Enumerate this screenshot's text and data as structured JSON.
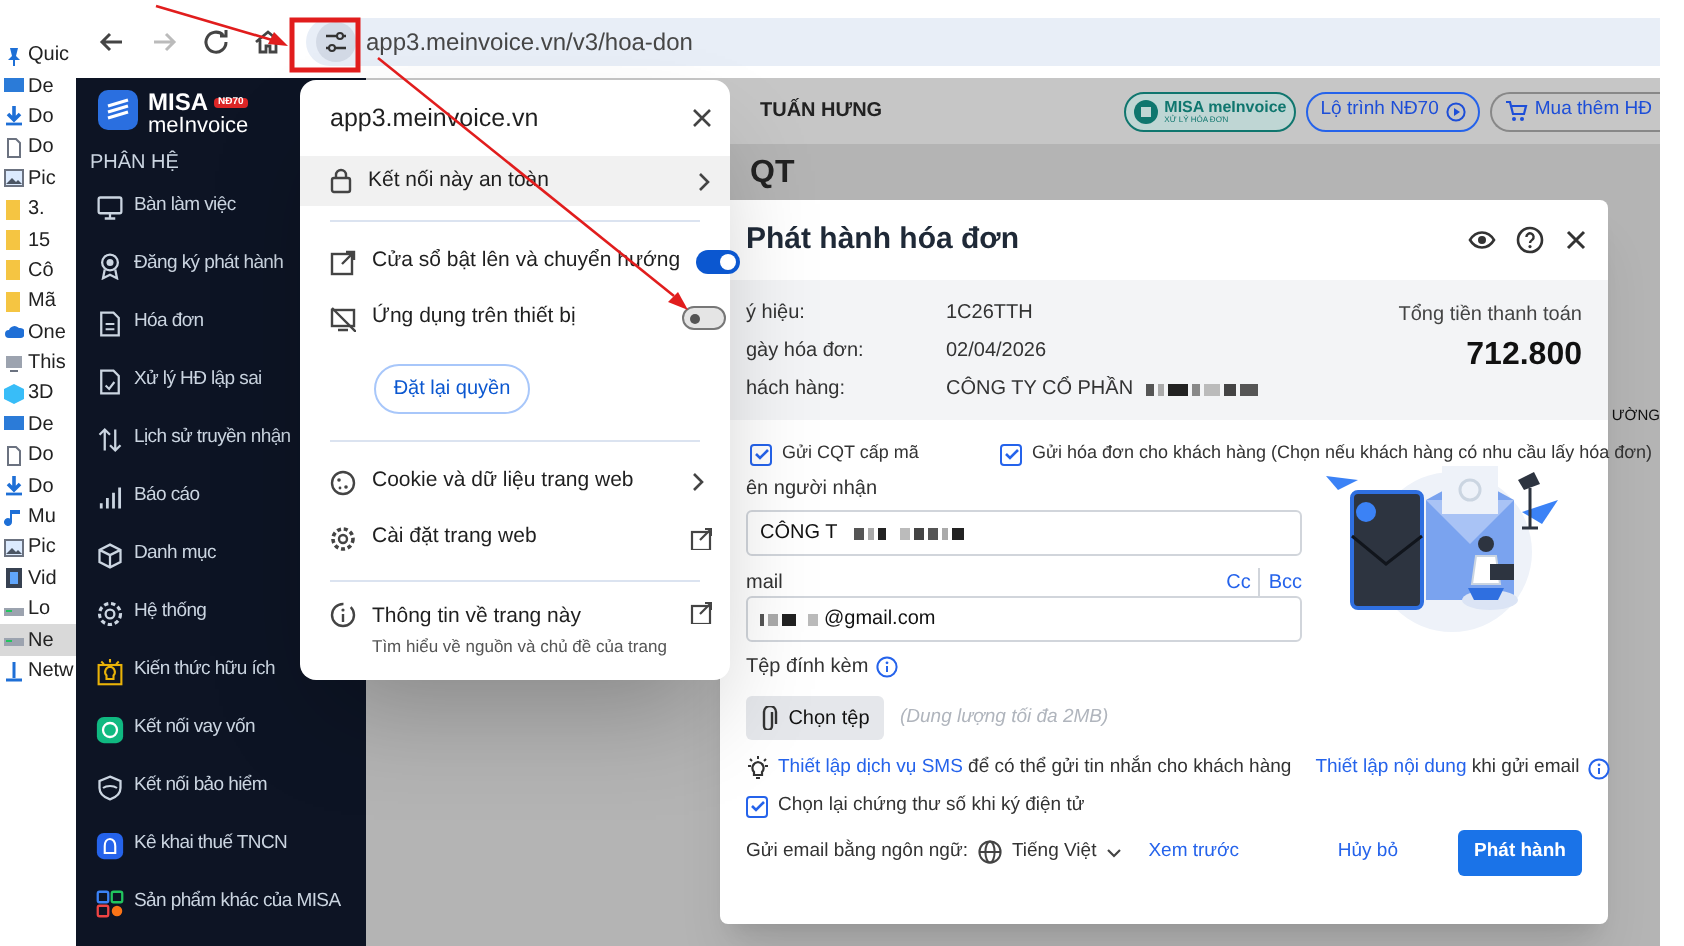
{
  "explorer_items": [
    {
      "label": "Quic",
      "kind": "pin",
      "selected": false
    },
    {
      "label": "De",
      "kind": "desktop",
      "selected": false
    },
    {
      "label": "Do",
      "kind": "download",
      "selected": false
    },
    {
      "label": "Do",
      "kind": "document",
      "selected": false
    },
    {
      "label": "Pic",
      "kind": "pictures",
      "selected": false
    },
    {
      "label": "3.",
      "kind": "folder",
      "selected": false
    },
    {
      "label": "15",
      "kind": "folder",
      "selected": false
    },
    {
      "label": "Cô",
      "kind": "folder",
      "selected": false
    },
    {
      "label": "Mã",
      "kind": "folder",
      "selected": false
    },
    {
      "label": "One",
      "kind": "cloud",
      "selected": false
    },
    {
      "label": "This",
      "kind": "pc",
      "selected": false
    },
    {
      "label": "3D",
      "kind": "cube",
      "selected": false
    },
    {
      "label": "De",
      "kind": "desktop",
      "selected": false
    },
    {
      "label": "Do",
      "kind": "document",
      "selected": false
    },
    {
      "label": "Do",
      "kind": "download",
      "selected": false
    },
    {
      "label": "Mu",
      "kind": "music",
      "selected": false
    },
    {
      "label": "Pic",
      "kind": "pictures",
      "selected": false
    },
    {
      "label": "Vid",
      "kind": "video",
      "selected": false
    },
    {
      "label": "Lo",
      "kind": "drive",
      "selected": false
    },
    {
      "label": "Ne",
      "kind": "drive",
      "selected": true
    },
    {
      "label": "Netw",
      "kind": "network",
      "selected": false
    }
  ],
  "browser": {
    "url": "app3.meinvoice.vn/v3/hoa-don"
  },
  "sidebar": {
    "logo_top": "MISA",
    "logo_bottom": "meInvoice",
    "badge": "NĐ70",
    "section": "PHÂN HỆ",
    "items": [
      {
        "label": "Bàn làm việc",
        "kind": "desktop"
      },
      {
        "label": "Đăng ký phát hành",
        "kind": "award"
      },
      {
        "label": "Hóa đơn",
        "kind": "document"
      },
      {
        "label": "Xử lý HĐ lập sai",
        "kind": "document_check"
      },
      {
        "label": "Lịch sử truyền nhận",
        "kind": "transfer"
      },
      {
        "label": "Báo cáo",
        "kind": "chart"
      },
      {
        "label": "Danh mục",
        "kind": "box"
      },
      {
        "label": "Hệ thống",
        "kind": "gear"
      },
      {
        "label": "Kiến thức hữu ích",
        "kind": "bulb"
      },
      {
        "label": "Kết nối vay vốn",
        "kind": "loan"
      },
      {
        "label": "Kết nối bảo hiểm",
        "kind": "shield"
      },
      {
        "label": "Kê khai thuế TNCN",
        "kind": "tax"
      },
      {
        "label": "Sản phẩm khác của MISA",
        "kind": "apps"
      }
    ]
  },
  "header": {
    "company": "TUẤN HƯNG",
    "buttons": [
      {
        "kind": "brand",
        "label": "MISA meInvoice",
        "sublabel": "XỬ LÝ HÓA ĐƠN"
      },
      {
        "kind": "route",
        "label": "Lộ trình NĐ70"
      },
      {
        "kind": "buy",
        "label": "Mua thêm HĐ"
      }
    ]
  },
  "page": {
    "title": "QT",
    "column_fragment": "ƯỜNG"
  },
  "site_popup": {
    "domain": "app3.meinvoice.vn",
    "connection": "Kết nối này an toàn",
    "permissions": [
      {
        "label": "Cửa sổ bật lên và chuyển hướng",
        "kind": "popup",
        "on": true
      },
      {
        "label": "Ứng dụng trên thiết bị",
        "kind": "device",
        "on": false
      }
    ],
    "reset_button": "Đặt lại quyền",
    "links": [
      {
        "label": "Cookie và dữ liệu trang web",
        "kind": "cookie"
      },
      {
        "label": "Cài đặt trang web",
        "kind": "settings"
      }
    ],
    "about": {
      "title": "Thông tin về trang này",
      "subtitle": "Tìm hiểu về nguồn và chủ đề của trang"
    }
  },
  "dialog": {
    "title": "Phát hành hóa đơn",
    "info": [
      {
        "label": "ý hiệu:",
        "value": "1C26TTH",
        "redacted": false
      },
      {
        "label": "gày hóa đơn:",
        "value": "02/04/2026",
        "redacted": false
      },
      {
        "label": "hách hàng:",
        "value": "CÔNG TY CỔ PHẦN",
        "redacted": true
      }
    ],
    "total_label": "Tổng tiền thanh toán",
    "total": "712.800",
    "options": [
      {
        "label": "Gửi CQT cấp mã",
        "checked": true
      },
      {
        "label": "Gửi hóa đơn cho khách hàng (Chọn nếu khách hàng có nhu cầu lấy hóa đơn)",
        "checked": true
      }
    ],
    "recipient": {
      "label": "ên người nhận",
      "value": "CÔNG T",
      "redacted": true
    },
    "email": {
      "label": "mail",
      "value": "@gmail.com",
      "redacted": true,
      "cc": "Cc",
      "bcc": "Bcc"
    },
    "attachment": {
      "label": "Tệp đính kèm",
      "button": "Chọn tệp",
      "hint": "(Dung lượng tối đa 2MB)"
    },
    "hint_parts": [
      {
        "link": "Thiết lập dịch vụ SMS",
        "text": "để có thể gửi tin nhắn cho khách hàng"
      },
      {
        "link": "Thiết lập nội dung",
        "text": "khi gửi email"
      }
    ],
    "reselect_cert": {
      "label": "Chọn lại chứng thư số khi ký điện tử",
      "checked": true
    },
    "language_label": "Gửi email bằng ngôn ngữ:",
    "language": "Tiếng Việt",
    "preview": "Xem trước",
    "cancel": "Hủy bỏ",
    "submit": "Phát hành"
  }
}
